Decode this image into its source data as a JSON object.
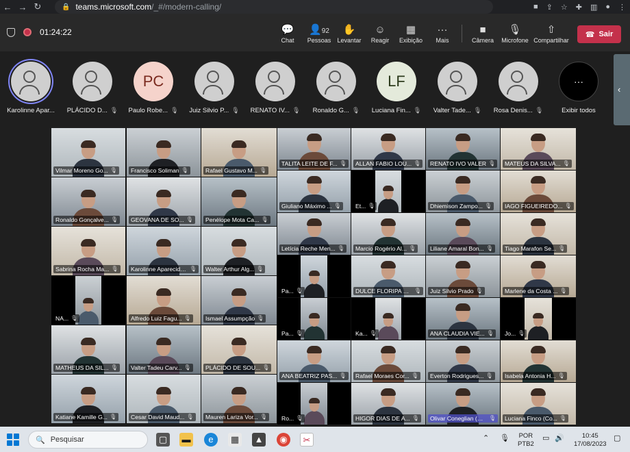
{
  "browser": {
    "url_host": "teams.microsoft.com",
    "url_path": "/_#/modern-calling/"
  },
  "toolbar": {
    "call_timer": "01:24:22",
    "participant_count": "92",
    "buttons": {
      "chat": "Chat",
      "people": "Pessoas",
      "raise_hand": "Levantar",
      "react": "Reagir",
      "view": "Exibição",
      "more": "Mais",
      "camera": "Câmera",
      "mic": "Microfone",
      "share": "Compartilhar"
    },
    "leave_label": "Sair"
  },
  "strip": {
    "participants": [
      {
        "name": "Karolinne Apar...",
        "initials": "",
        "muted": false
      },
      {
        "name": "PLÁCIDO D...",
        "initials": "",
        "muted": true
      },
      {
        "name": "Paulo Robe...",
        "initials": "PC",
        "muted": true
      },
      {
        "name": "Juiz Silvio P...",
        "initials": "",
        "muted": true
      },
      {
        "name": "RENATO IV...",
        "initials": "",
        "muted": true
      },
      {
        "name": "Ronaldo G...",
        "initials": "",
        "muted": true
      },
      {
        "name": "Luciana Fin...",
        "initials": "LF",
        "muted": true
      },
      {
        "name": "Valter Tade...",
        "initials": "",
        "muted": true
      },
      {
        "name": "Rosa Denis...",
        "initials": "",
        "muted": true
      }
    ],
    "more_label": "Exibir todos",
    "more_glyph": "···"
  },
  "tiles_left": [
    "Vilmar Moreno Go...",
    "Francisco Soliman",
    "Rafael Gustavo M...",
    "Ronaldo Gonçalve...",
    "GEOVANA DE SO...",
    "Penélope Mota Ca...",
    "Sabrina Rocha Ma...",
    "Karolinne Aparecida ...",
    "Walter Arthur Alg...",
    "NA...",
    "Alfredo Luiz Fagu...",
    "Ismael Assumpção",
    "MATHEUS DA SIL...",
    "Valter Tadeu Carv...",
    "PLÁCIDO DE SOU...",
    "Katiane Kamille G...",
    "Cesar David Maud...",
    "Mauren Lariza Vor..."
  ],
  "tiles_right": [
    "TALITA LEITE DE F...",
    "ALLAN FABIO LOU...",
    "RENATO IVO VALER",
    "MATEUS DA SILVA...",
    "Giuliano Máximo ...",
    "Et...",
    "Dhiemison Zampo...",
    "IAGO FIGUEIREDO...",
    "Letícia Reche Men...",
    "Marcio Rogério Al...",
    "Liliane Amaral Bon...",
    "Tiago Marafon Se...",
    "Pa...",
    "DULCE FLORIPA C...",
    "Juiz Silvio Prado",
    "Marlene da Costa ...",
    "Pa...",
    "Ka...",
    "ANA CLAUDIA VIE...",
    "Jo...",
    "ANA BEATRIZ PAS...",
    "Rafael Moraes Cor...",
    "Everton Rodrigues...",
    "Isabela Antonia H...",
    "Ro...",
    "HIGOR DIAS DE A...",
    "Olivar Coneglian (Co...",
    "Luciana Finco (Co..."
  ],
  "taskbar": {
    "search_placeholder": "Pesquisar",
    "lang_top": "POR",
    "lang_bottom": "PTB2",
    "time": "10:45",
    "date": "17/08/2023"
  }
}
